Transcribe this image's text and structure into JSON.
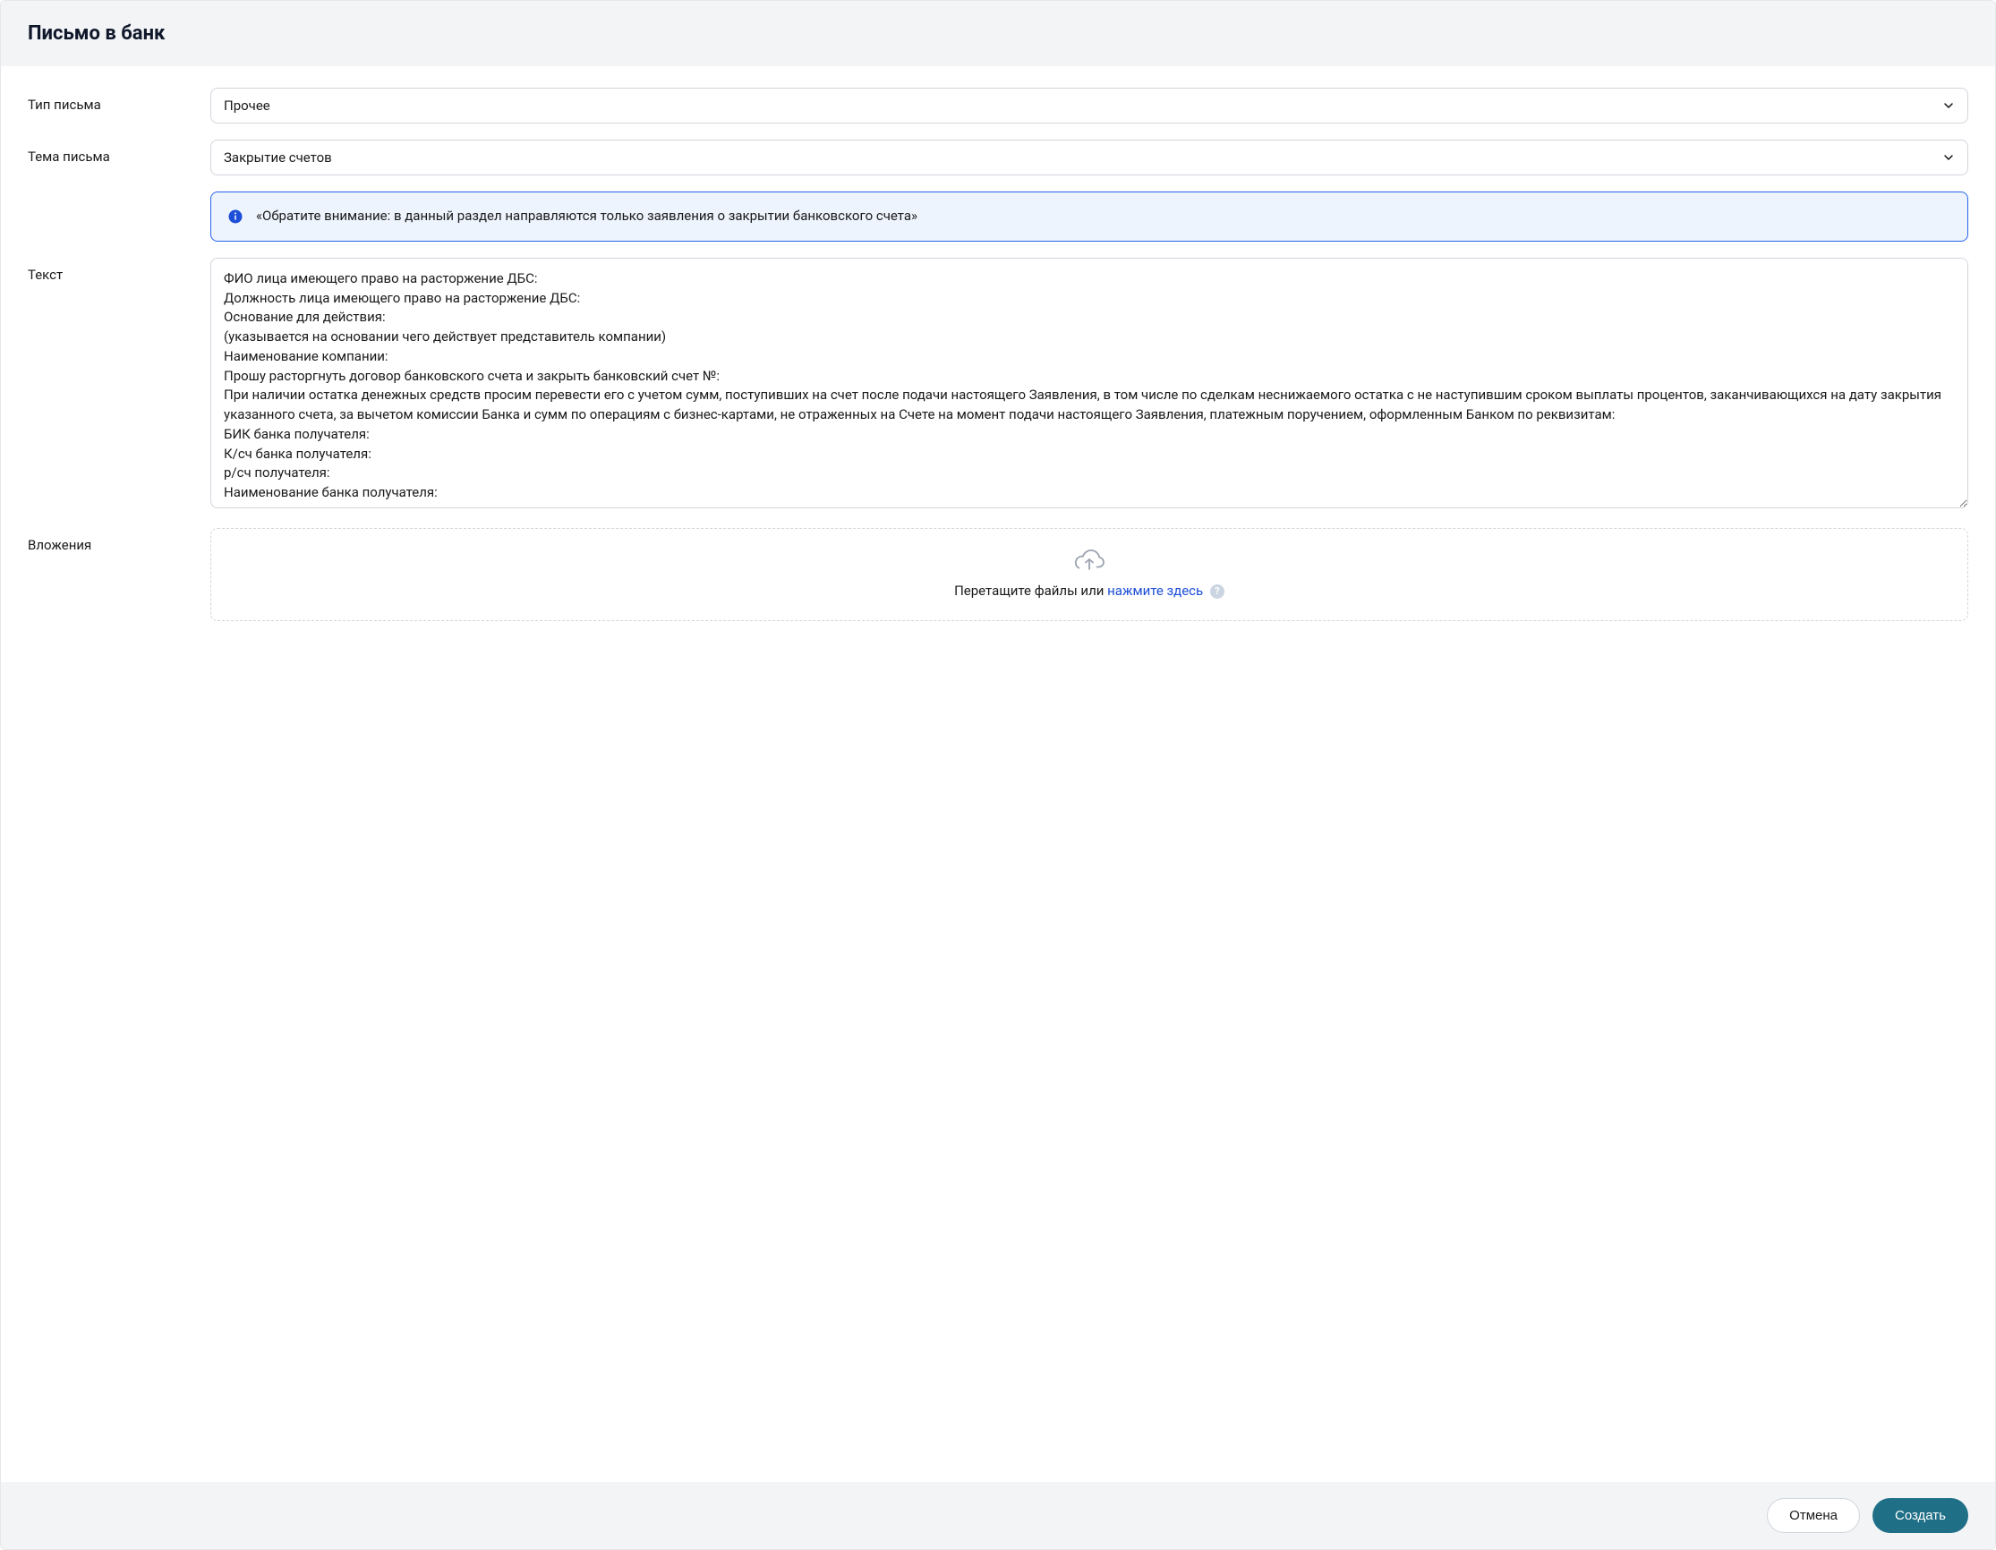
{
  "header": {
    "title": "Письмо в банк"
  },
  "form": {
    "letter_type": {
      "label": "Тип письма",
      "value": "Прочее"
    },
    "subject": {
      "label": "Тема письма",
      "value": "Закрытие счетов",
      "notice": "«Обратите внимание: в данный раздел направляются только заявления о закрытии банковского счета»"
    },
    "body": {
      "label": "Текст",
      "value": "ФИО лица имеющего право на расторжение ДБС:\nДолжность лица имеющего право на расторжение ДБС:\nОснование для действия:\n(указывается на основании чего действует представитель компании)\nНаименование компании:\nПрошу расторгнуть договор банковского счета и закрыть банковский счет №:\nПри наличии остатка денежных средств просим перевести его с учетом сумм, поступивших на счет после подачи настоящего Заявления, в том числе по сделкам неснижаемого остатка с не наступившим сроком выплаты процентов, заканчивающихся на дату закрытия указанного счета, за вычетом комиссии Банка и сумм по операциям с бизнес-картами, не отраженных на Счете на момент подачи настоящего Заявления, платежным поручением, оформленным Банком по реквизитам:\nБИК банка получателя:\nК/сч банка получателя:\nр/сч получателя:\nНаименование банка получателя:"
    },
    "attachments": {
      "label": "Вложения",
      "drop_text": "Перетащите файлы или ",
      "drop_link": "нажмите здесь"
    }
  },
  "footer": {
    "cancel": "Отмена",
    "submit": "Создать"
  }
}
